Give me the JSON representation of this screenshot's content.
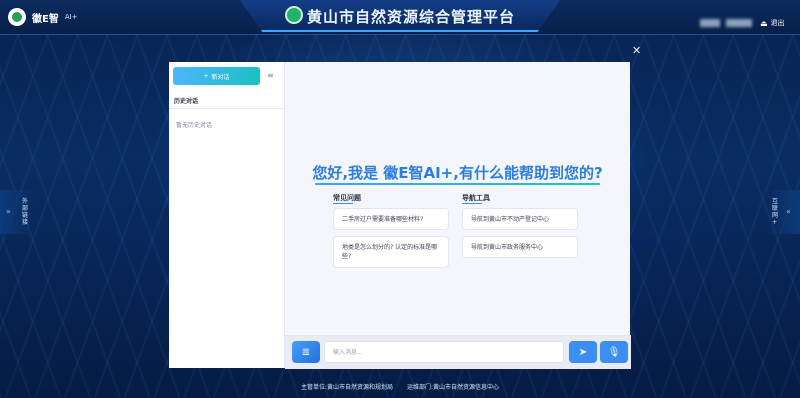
{
  "header": {
    "title": "黄山市自然资源综合管理平台",
    "brand_text": "徽E智",
    "brand_ai": "AI+",
    "logout_label": "退出"
  },
  "side_left": {
    "label": "外部链接"
  },
  "side_right": {
    "label": "互联网+"
  },
  "sidebar": {
    "new_chat_label": "新对话",
    "history_title": "历史对话",
    "empty_text": "暂无历史对话"
  },
  "greeting": "您好,我是 徽E智AI+,有什么能帮助到您的?",
  "faq": {
    "title": "常见问题",
    "items": [
      "二手房过户需要准备哪些材料?",
      "地类是怎么划分的? 认定的标准是哪些?"
    ]
  },
  "nav_tools": {
    "title": "导航工具",
    "items": [
      "导航到黄山市不动产登记中心",
      "导航到黄山市政务服务中心"
    ]
  },
  "composer": {
    "placeholder": "输入消息..."
  },
  "footer": {
    "host": "主管单位:黄山市自然资源和规划局",
    "ops": "运维部门:黄山市自然资源信息中心"
  },
  "colors": {
    "accent": "#2b7de0",
    "header_bg": "#0b2a5e",
    "button_gradient_start": "#4fb4ff",
    "button_gradient_end": "#19c2c0"
  }
}
